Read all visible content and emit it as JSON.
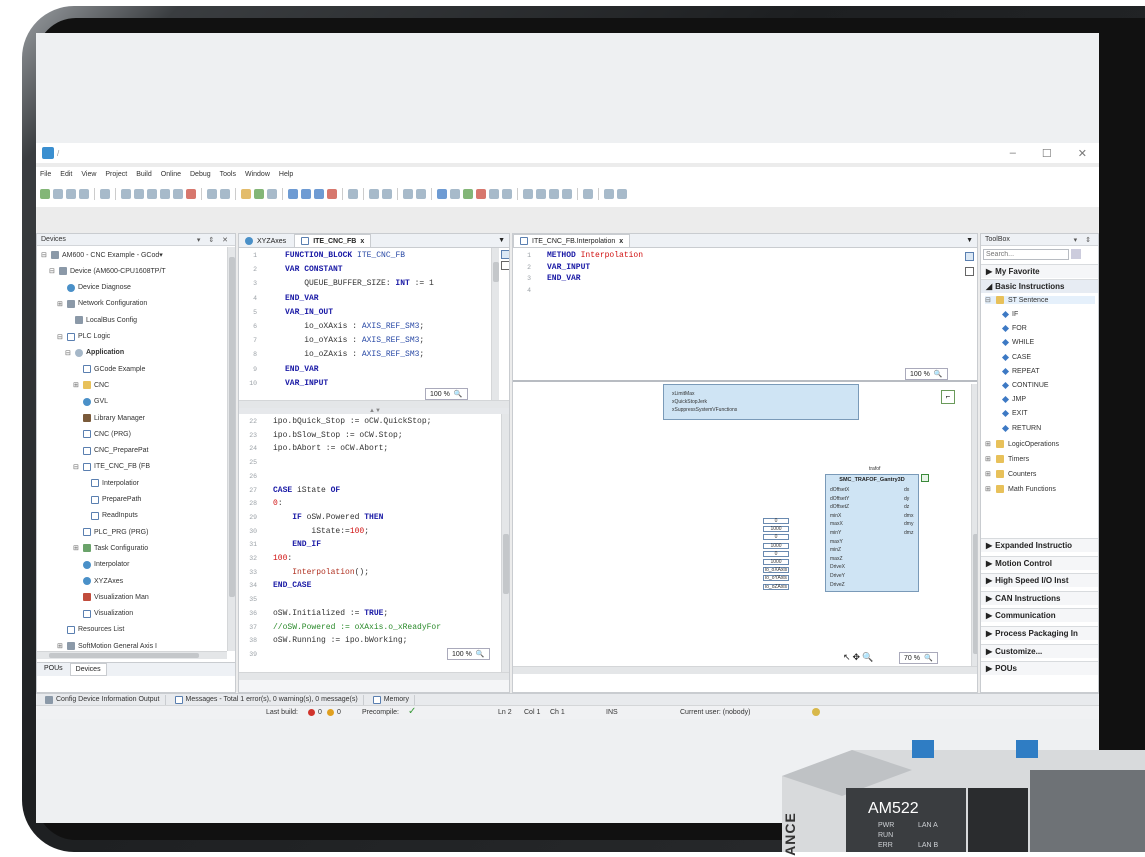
{
  "window": {
    "title_sep": "/",
    "controls": [
      "–",
      "☐",
      "✕"
    ]
  },
  "menu": [
    "File",
    "Edit",
    "View",
    "Project",
    "Build",
    "Online",
    "Debug",
    "Tools",
    "Window",
    "Help"
  ],
  "devices_panel": {
    "title": "Devices",
    "controls": "▾ ⇕ ✕",
    "tree": [
      {
        "label": "AM600 - CNC Example - GCod▾",
        "indent": 0,
        "icon": "dev",
        "exp": "⊟"
      },
      {
        "label": "Device (AM600-CPU1608TP/T",
        "indent": 1,
        "icon": "dev",
        "exp": "⊟"
      },
      {
        "label": "Device Diagnose",
        "indent": 2,
        "icon": "gvl",
        "exp": ""
      },
      {
        "label": "Network Configuration",
        "indent": 2,
        "icon": "dev",
        "exp": "⊞"
      },
      {
        "label": "LocalBus Config",
        "indent": 3,
        "icon": "dev",
        "exp": ""
      },
      {
        "label": "PLC Logic",
        "indent": 2,
        "icon": "prg",
        "exp": "⊟"
      },
      {
        "label": "Application",
        "indent": 3,
        "icon": "app",
        "exp": "⊟",
        "bold": true
      },
      {
        "label": "GCode Example",
        "indent": 4,
        "icon": "prg",
        "exp": ""
      },
      {
        "label": "CNC",
        "indent": 4,
        "icon": "fold",
        "exp": "⊞"
      },
      {
        "label": "GVL",
        "indent": 4,
        "icon": "gvl",
        "exp": ""
      },
      {
        "label": "Library Manager",
        "indent": 4,
        "icon": "lib",
        "exp": ""
      },
      {
        "label": "CNC (PRG)",
        "indent": 4,
        "icon": "prg",
        "exp": ""
      },
      {
        "label": "CNC_PreparePat",
        "indent": 4,
        "icon": "prg",
        "exp": ""
      },
      {
        "label": "ITE_CNC_FB (FB",
        "indent": 4,
        "icon": "prg",
        "exp": "⊟"
      },
      {
        "label": "Interpolatior",
        "indent": 5,
        "icon": "prg",
        "exp": ""
      },
      {
        "label": "PreparePath",
        "indent": 5,
        "icon": "prg",
        "exp": ""
      },
      {
        "label": "ReadInputs",
        "indent": 5,
        "icon": "prg",
        "exp": ""
      },
      {
        "label": "PLC_PRG (PRG)",
        "indent": 4,
        "icon": "prg",
        "exp": ""
      },
      {
        "label": "Task Configuratio",
        "indent": 4,
        "icon": "tsk",
        "exp": "⊞"
      },
      {
        "label": "Interpolator",
        "indent": 4,
        "icon": "gvl",
        "exp": ""
      },
      {
        "label": "XYZAxes",
        "indent": 4,
        "icon": "gvl",
        "exp": ""
      },
      {
        "label": "Visualization Man",
        "indent": 4,
        "icon": "red",
        "exp": ""
      },
      {
        "label": "Visualization",
        "indent": 4,
        "icon": "prg",
        "exp": ""
      },
      {
        "label": "Resources List",
        "indent": 2,
        "icon": "prg",
        "exp": ""
      },
      {
        "label": "SoftMotion General Axis I",
        "indent": 2,
        "icon": "dev",
        "exp": "⊞"
      }
    ],
    "bottom_tabs": [
      "POUs",
      "Devices"
    ]
  },
  "editor_left": {
    "tabs": [
      {
        "label": "XYZAxes",
        "active": false
      },
      {
        "label": "ITE_CNC_FB",
        "active": true,
        "close": "x"
      }
    ],
    "top_lines": [
      {
        "n": "1",
        "html": "<span class='kw'>FUNCTION_BLOCK</span> <span class='ty'>ITE_CNC_FB</span>"
      },
      {
        "n": "2",
        "html": "<span class='kw'>VAR CONSTANT</span>"
      },
      {
        "n": "3",
        "html": "    QUEUE_BUFFER_SIZE: <span class='kw'>INT</span> := 1"
      },
      {
        "n": "4",
        "html": "<span class='kw'>END_VAR</span>"
      },
      {
        "n": "5",
        "html": "<span class='kw'>VAR_IN_OUT</span>"
      },
      {
        "n": "6",
        "html": "    io_oXAxis : <span class='ty'>AXIS_REF_SM3</span>;"
      },
      {
        "n": "7",
        "html": "    io_oYAxis : <span class='ty'>AXIS_REF_SM3</span>;"
      },
      {
        "n": "8",
        "html": "    io_oZAxis : <span class='ty'>AXIS_REF_SM3</span>;"
      },
      {
        "n": "9",
        "html": "<span class='kw'>END_VAR</span>"
      },
      {
        "n": "10",
        "html": "<span class='kw'>VAR_INPUT</span>"
      }
    ],
    "top_zoom": "100 %",
    "bottom_lines": [
      {
        "n": "22",
        "html": "ipo.bQuick_Stop := oCW.QuickStop;"
      },
      {
        "n": "23",
        "html": "ipo.bSlow_Stop := oCW.Stop;"
      },
      {
        "n": "24",
        "html": "ipo.bAbort := oCW.Abort;"
      },
      {
        "n": "25",
        "html": ""
      },
      {
        "n": "26",
        "html": ""
      },
      {
        "n": "27",
        "html": "<span class='kw'>CASE</span> iState <span class='kw'>OF</span>"
      },
      {
        "n": "28",
        "html": "<span class='num'>0</span>:"
      },
      {
        "n": "29",
        "html": "    <span class='kw'>IF</span> oSW.Powered <span class='kw'>THEN</span>"
      },
      {
        "n": "30",
        "html": "        iState:=<span class='num'>100</span>;"
      },
      {
        "n": "31",
        "html": "    <span class='kw'>END_IF</span>"
      },
      {
        "n": "32",
        "html": "<span class='num'>100</span>:"
      },
      {
        "n": "33",
        "html": "    <span class='str'>Interpolation</span>();"
      },
      {
        "n": "34",
        "html": "<span class='kw'>END_CASE</span>"
      },
      {
        "n": "35",
        "html": ""
      },
      {
        "n": "36",
        "html": "oSW.Initialized := <span class='kw'>TRUE</span>;"
      },
      {
        "n": "37",
        "html": "<span class='cmt'>//oSW.Powered := oXAxis.o_xReadyFor</span>"
      },
      {
        "n": "38",
        "html": "oSW.Running := ipo.bWorking;"
      },
      {
        "n": "39",
        "html": ""
      }
    ],
    "bottom_zoom": "100 %"
  },
  "editor_right": {
    "tab": "ITE_CNC_FB.Interpolation",
    "tab_close": "x",
    "lines": [
      {
        "n": "1",
        "html": "<span class='kw'>METHOD</span> <span class='num'>Interpolation</span>"
      },
      {
        "n": "2",
        "html": "<span class='kw'>VAR_INPUT</span>"
      },
      {
        "n": "3",
        "html": "<span class='kw'>END_VAR</span>"
      },
      {
        "n": "4",
        "html": ""
      }
    ],
    "zoom": "100 %",
    "diagram_zoom": "70 %",
    "upper_block_pins": [
      "xQuickStopJerk",
      "xSuppressSystemVFunctions",
      "xLimitMax"
    ],
    "fb": {
      "instance": "trafof",
      "title": "SMC_TRAFOF_Gantry3D",
      "inputs": [
        "dOffsetX",
        "dOffsetY",
        "dOffsetZ",
        "minX",
        "maxX",
        "minY",
        "maxY",
        "minZ",
        "maxZ",
        "DriveX",
        "DriveY",
        "DriveZ"
      ],
      "outputs": [
        "dx",
        "dy",
        "dz",
        "dmx",
        "dmy",
        "dmz"
      ],
      "input_values": [
        "0",
        "1000",
        "0",
        "1000",
        "0",
        "1000",
        "io_oXAxis",
        "io_oYAxis",
        "io_oZAxis"
      ]
    }
  },
  "toolbox": {
    "title": "ToolBox",
    "controls": "▾ ⇕",
    "search_placeholder": "Search...",
    "sections": [
      "My Favorite",
      "Basic Instructions"
    ],
    "st_sentence": "ST Sentence",
    "st_items": [
      "IF",
      "FOR",
      "WHILE",
      "CASE",
      "REPEAT",
      "CONTINUE",
      "JMP",
      "EXIT",
      "RETURN"
    ],
    "folders": [
      "LogicOperations",
      "Timers",
      "Counters",
      "Math Functions"
    ],
    "more_sections": [
      "Expanded Instructio",
      "Motion Control",
      "High Speed I/O Inst",
      "CAN Instructions",
      "Communication",
      "Process Packaging In",
      "Customize...",
      "POUs"
    ]
  },
  "output_tabs": {
    "config": "Config Device Information Output",
    "messages": "Messages - Total 1 error(s), 0 warning(s), 0 message(s)",
    "memory": "Memory"
  },
  "status": {
    "last_build_label": "Last build:",
    "errors": "0",
    "warnings": "0",
    "precompile_label": "Precompile:",
    "ln": "Ln 2",
    "col": "Col 1",
    "ch": "Ch 1",
    "ins": "INS",
    "user": "Current user: (nobody)"
  },
  "hardware": {
    "model": "AM522",
    "leds": [
      "PWR",
      "RUN",
      "ERR"
    ],
    "lan": [
      "LAN A",
      "LAN B"
    ],
    "brand_fragment": "ANCE"
  }
}
